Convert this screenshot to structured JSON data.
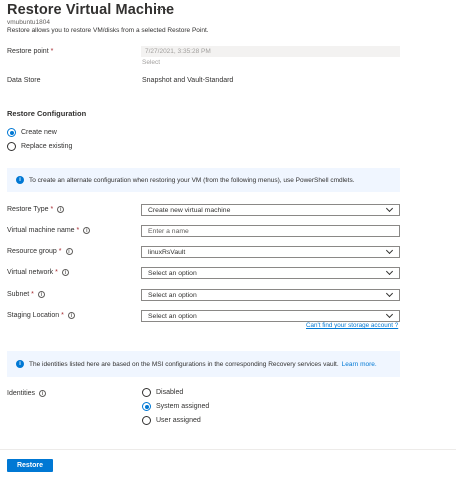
{
  "header": {
    "title": "Restore Virtual Machine",
    "more_label": "···",
    "subtitle": "vmubuntu1804",
    "description": "Restore allows you to restore VM/disks from a selected Restore Point."
  },
  "restore_point": {
    "label": "Restore point",
    "required_mark": "*",
    "value": "7/27/2021, 3:35:28 PM",
    "select_label": "Select"
  },
  "data_store": {
    "label": "Data Store",
    "value": "Snapshot and Vault-Standard"
  },
  "restore_configuration": {
    "title": "Restore Configuration",
    "options": [
      {
        "label": "Create new",
        "selected": true
      },
      {
        "label": "Replace existing",
        "selected": false
      }
    ]
  },
  "info_banner_1": {
    "icon": "info-icon",
    "text": "To create an alternate configuration when restoring your VM (from the following menus), use PowerShell cmdlets."
  },
  "form": {
    "restore_type": {
      "label": "Restore Type",
      "value": "Create new virtual machine"
    },
    "vm_name": {
      "label": "Virtual machine name",
      "placeholder": "Enter a name"
    },
    "resource_group": {
      "label": "Resource group",
      "value": "linuxRsVault"
    },
    "virtual_network": {
      "label": "Virtual network",
      "value": "Select an option"
    },
    "subnet": {
      "label": "Subnet",
      "value": "Select an option"
    },
    "staging_location": {
      "label": "Staging Location",
      "value": "Select an option"
    },
    "storage_link": "Can't find your storage account ?"
  },
  "info_banner_2": {
    "icon": "info-icon",
    "text": "The identities listed here are based on the MSI configurations in the corresponding Recovery services vault.",
    "link": "Learn more."
  },
  "identities": {
    "label": "Identities",
    "options": [
      {
        "label": "Disabled",
        "selected": false
      },
      {
        "label": "System assigned",
        "selected": true
      },
      {
        "label": "User assigned",
        "selected": false
      }
    ]
  },
  "footer": {
    "restore_button": "Restore"
  },
  "colors": {
    "accent": "#0078d4",
    "required": "#a4262c",
    "banner_bg": "#f0f6ff"
  }
}
